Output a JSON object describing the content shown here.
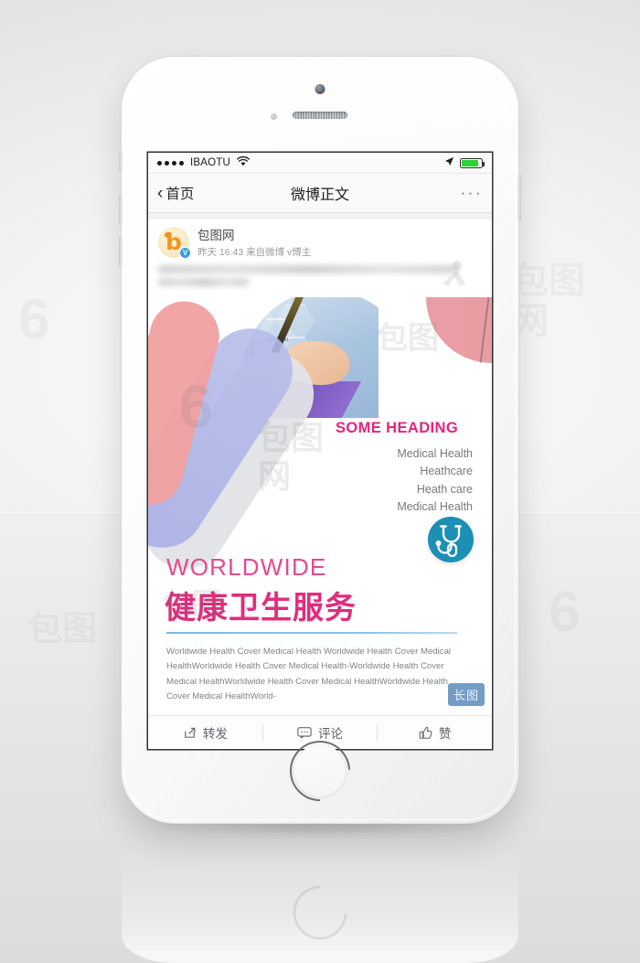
{
  "device": {
    "name": "iphone-mockup",
    "home_button": "home-button"
  },
  "status_bar": {
    "signal_dots": 4,
    "carrier": "IBAOTU",
    "wifi_icon": "wifi-icon",
    "location_icon": "location-arrow-icon",
    "battery_icon": "battery-icon",
    "battery_level": 85,
    "battery_color": "#2ed03a"
  },
  "nav_bar": {
    "back_label": "首页",
    "back_icon": "chevron-left-icon",
    "title": "微博正文",
    "more_label": "···",
    "more_icon": "more-horizontal-icon"
  },
  "post": {
    "avatar_letter": "b",
    "verified_badge": "V",
    "username": "包图网",
    "timestamp": "昨天 16:43",
    "source": "来自微博 v博主",
    "body_text_blurred": true
  },
  "poster": {
    "heading": "SOME HEADING",
    "heading_color": "#e4247c",
    "sub_items": [
      "Medical Health",
      "Heathcare",
      "Heath care",
      "Medical Health"
    ],
    "worldwide": "WORLDWIDE",
    "worldwide_color": "#e8488f",
    "chinese_title": "健康卫生服务",
    "chinese_title_color": "#e02d7c",
    "stethoscope_icon": "stethoscope-icon",
    "stethoscope_bg": "#1d8eb4",
    "rule_color": "#7fb7e0",
    "paragraph": "Worldwide Health Cover Medical Health Worldwide Health Cover Medical HealthWorldwide Health Cover Medical Health-Worldwide Health Cover Medical HealthWorldwide Health Cover Medical HealthWorldwide Health Cover Medical HealthWorld-",
    "long_image_badge": "长图",
    "shape_colors": {
      "salmon": "#f0a0a0",
      "purple": "#b6bcea",
      "gray": "#e2e3e7",
      "quarter_pink": "#e8959c"
    },
    "photo_label": "MEDICAL"
  },
  "action_bar": {
    "items": [
      {
        "label": "转发",
        "icon": "share-icon"
      },
      {
        "label": "评论",
        "icon": "comment-icon"
      },
      {
        "label": "赞",
        "icon": "thumbs-up-icon"
      }
    ]
  },
  "watermark": {
    "text": "包图网",
    "mark": "6"
  }
}
